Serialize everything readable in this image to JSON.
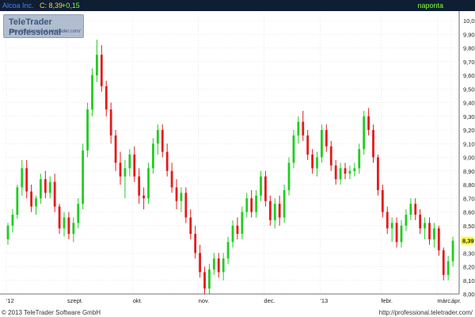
{
  "header": {
    "symbol": "Alcoa Inc.",
    "close_label": "C: 8,39",
    "change_label": "+0,15",
    "period": "naponta"
  },
  "logo": {
    "name": "TeleTrader Professional",
    "url": "http://professional.teletrader.com/"
  },
  "footer": {
    "copyright": "© 2013 TeleTrader Software GmbH",
    "url": "http://professional.teletrader.com/"
  },
  "colors": {
    "up": "#22cc22",
    "down": "#e31b1b",
    "grid": "#d9d9d9",
    "header_bg": "#0f1e33",
    "last_price_marker": "#ffff33"
  },
  "chart_data": {
    "type": "candlestick",
    "title": "Alcoa Inc.",
    "ylim": [
      8.0,
      10.0
    ],
    "y_ticks": [
      "10,00",
      "9,90",
      "9,80",
      "9,70",
      "9,60",
      "9,50",
      "9,40",
      "9,30",
      "9,20",
      "9,10",
      "9,00",
      "8,90",
      "8,80",
      "8,70",
      "8,60",
      "8,50",
      "8,40",
      "8,30",
      "8,20",
      "8,10",
      "8,00"
    ],
    "x_ticks": [
      "'12",
      "szept.",
      "okt.",
      "nov.",
      "dec.",
      "'13",
      "febr.",
      "márc.",
      "ápr."
    ],
    "last_price": "8,39",
    "grid": true,
    "candles": [
      {
        "o": 8.4,
        "h": 8.52,
        "l": 8.36,
        "c": 8.5
      },
      {
        "o": 8.5,
        "h": 8.62,
        "l": 8.45,
        "c": 8.58
      },
      {
        "o": 8.58,
        "h": 8.8,
        "l": 8.55,
        "c": 8.78
      },
      {
        "o": 8.78,
        "h": 8.98,
        "l": 8.72,
        "c": 8.92
      },
      {
        "o": 8.92,
        "h": 8.98,
        "l": 8.7,
        "c": 8.75
      },
      {
        "o": 8.75,
        "h": 8.8,
        "l": 8.6,
        "c": 8.64
      },
      {
        "o": 8.64,
        "h": 8.72,
        "l": 8.58,
        "c": 8.7
      },
      {
        "o": 8.7,
        "h": 8.88,
        "l": 8.66,
        "c": 8.84
      },
      {
        "o": 8.84,
        "h": 8.9,
        "l": 8.7,
        "c": 8.74
      },
      {
        "o": 8.74,
        "h": 8.86,
        "l": 8.7,
        "c": 8.82
      },
      {
        "o": 8.82,
        "h": 8.88,
        "l": 8.6,
        "c": 8.64
      },
      {
        "o": 8.64,
        "h": 8.66,
        "l": 8.44,
        "c": 8.48
      },
      {
        "o": 8.48,
        "h": 8.6,
        "l": 8.42,
        "c": 8.56
      },
      {
        "o": 8.56,
        "h": 8.6,
        "l": 8.4,
        "c": 8.44
      },
      {
        "o": 8.44,
        "h": 8.56,
        "l": 8.38,
        "c": 8.52
      },
      {
        "o": 8.52,
        "h": 8.7,
        "l": 8.48,
        "c": 8.66
      },
      {
        "o": 8.66,
        "h": 9.1,
        "l": 8.62,
        "c": 9.05
      },
      {
        "o": 9.05,
        "h": 9.4,
        "l": 9.0,
        "c": 9.35
      },
      {
        "o": 9.35,
        "h": 9.65,
        "l": 9.3,
        "c": 9.6
      },
      {
        "o": 9.6,
        "h": 9.86,
        "l": 9.55,
        "c": 9.75
      },
      {
        "o": 9.75,
        "h": 9.82,
        "l": 9.48,
        "c": 9.52
      },
      {
        "o": 9.52,
        "h": 9.56,
        "l": 9.3,
        "c": 9.35
      },
      {
        "o": 9.35,
        "h": 9.4,
        "l": 9.1,
        "c": 9.16
      },
      {
        "o": 9.16,
        "h": 9.2,
        "l": 8.9,
        "c": 8.96
      },
      {
        "o": 8.96,
        "h": 9.04,
        "l": 8.8,
        "c": 8.86
      },
      {
        "o": 8.86,
        "h": 8.98,
        "l": 8.7,
        "c": 8.92
      },
      {
        "o": 8.92,
        "h": 9.06,
        "l": 8.86,
        "c": 9.02
      },
      {
        "o": 9.02,
        "h": 9.08,
        "l": 8.82,
        "c": 8.86
      },
      {
        "o": 8.86,
        "h": 8.92,
        "l": 8.66,
        "c": 8.72
      },
      {
        "o": 8.72,
        "h": 8.78,
        "l": 8.62,
        "c": 8.7
      },
      {
        "o": 8.7,
        "h": 8.96,
        "l": 8.66,
        "c": 8.92
      },
      {
        "o": 8.92,
        "h": 9.14,
        "l": 8.88,
        "c": 9.1
      },
      {
        "o": 9.1,
        "h": 9.24,
        "l": 9.02,
        "c": 9.2
      },
      {
        "o": 9.2,
        "h": 9.24,
        "l": 9.0,
        "c": 9.04
      },
      {
        "o": 9.04,
        "h": 9.1,
        "l": 8.86,
        "c": 8.9
      },
      {
        "o": 8.9,
        "h": 8.96,
        "l": 8.74,
        "c": 8.78
      },
      {
        "o": 8.78,
        "h": 8.84,
        "l": 8.62,
        "c": 8.68
      },
      {
        "o": 8.68,
        "h": 8.78,
        "l": 8.6,
        "c": 8.74
      },
      {
        "o": 8.74,
        "h": 8.78,
        "l": 8.52,
        "c": 8.56
      },
      {
        "o": 8.56,
        "h": 8.62,
        "l": 8.4,
        "c": 8.44
      },
      {
        "o": 8.44,
        "h": 8.5,
        "l": 8.26,
        "c": 8.3
      },
      {
        "o": 8.3,
        "h": 8.36,
        "l": 8.12,
        "c": 8.16
      },
      {
        "o": 8.16,
        "h": 8.2,
        "l": 8.0,
        "c": 8.04
      },
      {
        "o": 8.04,
        "h": 8.22,
        "l": 8.0,
        "c": 8.18
      },
      {
        "o": 8.18,
        "h": 8.3,
        "l": 8.14,
        "c": 8.26
      },
      {
        "o": 8.26,
        "h": 8.3,
        "l": 8.12,
        "c": 8.16
      },
      {
        "o": 8.16,
        "h": 8.3,
        "l": 8.1,
        "c": 8.26
      },
      {
        "o": 8.26,
        "h": 8.42,
        "l": 8.22,
        "c": 8.38
      },
      {
        "o": 8.38,
        "h": 8.54,
        "l": 8.34,
        "c": 8.5
      },
      {
        "o": 8.5,
        "h": 8.56,
        "l": 8.4,
        "c": 8.44
      },
      {
        "o": 8.44,
        "h": 8.64,
        "l": 8.4,
        "c": 8.6
      },
      {
        "o": 8.6,
        "h": 8.74,
        "l": 8.56,
        "c": 8.7
      },
      {
        "o": 8.7,
        "h": 8.76,
        "l": 8.56,
        "c": 8.6
      },
      {
        "o": 8.6,
        "h": 8.76,
        "l": 8.56,
        "c": 8.72
      },
      {
        "o": 8.72,
        "h": 8.9,
        "l": 8.68,
        "c": 8.86
      },
      {
        "o": 8.86,
        "h": 8.9,
        "l": 8.64,
        "c": 8.68
      },
      {
        "o": 8.68,
        "h": 8.72,
        "l": 8.5,
        "c": 8.54
      },
      {
        "o": 8.54,
        "h": 8.7,
        "l": 8.48,
        "c": 8.66
      },
      {
        "o": 8.66,
        "h": 8.72,
        "l": 8.5,
        "c": 8.56
      },
      {
        "o": 8.56,
        "h": 8.8,
        "l": 8.52,
        "c": 8.76
      },
      {
        "o": 8.76,
        "h": 9.0,
        "l": 8.72,
        "c": 8.96
      },
      {
        "o": 8.96,
        "h": 9.2,
        "l": 8.92,
        "c": 9.16
      },
      {
        "o": 9.16,
        "h": 9.3,
        "l": 9.1,
        "c": 9.26
      },
      {
        "o": 9.26,
        "h": 9.34,
        "l": 9.12,
        "c": 9.16
      },
      {
        "o": 9.16,
        "h": 9.2,
        "l": 8.98,
        "c": 9.02
      },
      {
        "o": 9.02,
        "h": 9.06,
        "l": 8.88,
        "c": 8.92
      },
      {
        "o": 8.92,
        "h": 9.04,
        "l": 8.86,
        "c": 9.0
      },
      {
        "o": 9.0,
        "h": 9.24,
        "l": 8.96,
        "c": 9.2
      },
      {
        "o": 9.2,
        "h": 9.24,
        "l": 9.04,
        "c": 9.08
      },
      {
        "o": 9.08,
        "h": 9.12,
        "l": 8.9,
        "c": 8.94
      },
      {
        "o": 8.94,
        "h": 8.98,
        "l": 8.8,
        "c": 8.84
      },
      {
        "o": 8.84,
        "h": 8.96,
        "l": 8.8,
        "c": 8.92
      },
      {
        "o": 8.92,
        "h": 8.96,
        "l": 8.84,
        "c": 8.88
      },
      {
        "o": 8.88,
        "h": 8.94,
        "l": 8.84,
        "c": 8.9
      },
      {
        "o": 8.9,
        "h": 8.96,
        "l": 8.86,
        "c": 8.92
      },
      {
        "o": 8.92,
        "h": 9.1,
        "l": 8.88,
        "c": 9.06
      },
      {
        "o": 9.06,
        "h": 9.34,
        "l": 9.02,
        "c": 9.3
      },
      {
        "o": 9.3,
        "h": 9.36,
        "l": 9.16,
        "c": 9.2
      },
      {
        "o": 9.2,
        "h": 9.24,
        "l": 8.96,
        "c": 9.0
      },
      {
        "o": 9.0,
        "h": 9.02,
        "l": 8.72,
        "c": 8.76
      },
      {
        "o": 8.76,
        "h": 8.8,
        "l": 8.56,
        "c": 8.6
      },
      {
        "o": 8.6,
        "h": 8.64,
        "l": 8.44,
        "c": 8.48
      },
      {
        "o": 8.48,
        "h": 8.56,
        "l": 8.38,
        "c": 8.52
      },
      {
        "o": 8.52,
        "h": 8.56,
        "l": 8.34,
        "c": 8.38
      },
      {
        "o": 8.38,
        "h": 8.54,
        "l": 8.34,
        "c": 8.5
      },
      {
        "o": 8.5,
        "h": 8.62,
        "l": 8.46,
        "c": 8.58
      },
      {
        "o": 8.58,
        "h": 8.7,
        "l": 8.54,
        "c": 8.66
      },
      {
        "o": 8.66,
        "h": 8.7,
        "l": 8.54,
        "c": 8.58
      },
      {
        "o": 8.58,
        "h": 8.62,
        "l": 8.44,
        "c": 8.48
      },
      {
        "o": 8.48,
        "h": 8.56,
        "l": 8.4,
        "c": 8.52
      },
      {
        "o": 8.52,
        "h": 8.56,
        "l": 8.36,
        "c": 8.4
      },
      {
        "o": 8.4,
        "h": 8.52,
        "l": 8.34,
        "c": 8.48
      },
      {
        "o": 8.48,
        "h": 8.5,
        "l": 8.28,
        "c": 8.32
      },
      {
        "o": 8.32,
        "h": 8.34,
        "l": 8.1,
        "c": 8.14
      },
      {
        "o": 8.14,
        "h": 8.28,
        "l": 8.1,
        "c": 8.24
      },
      {
        "o": 8.24,
        "h": 8.42,
        "l": 8.2,
        "c": 8.39
      }
    ]
  }
}
